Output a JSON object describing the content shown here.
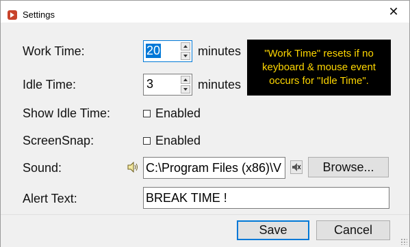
{
  "window": {
    "title": "Settings",
    "close_glyph": "✕"
  },
  "form": {
    "work_time": {
      "label": "Work Time:",
      "value": "20",
      "unit": "minutes"
    },
    "idle_time": {
      "label": "Idle Time:",
      "value": "3",
      "unit": "minutes"
    },
    "show_idle_time": {
      "label": "Show Idle Time:",
      "checkbox_label": "Enabled",
      "checked": false
    },
    "screen_snap": {
      "label": "ScreenSnap:",
      "checkbox_label": "Enabled",
      "checked": false
    },
    "sound": {
      "label": "Sound:",
      "path": "C:\\Program Files (x86)\\V",
      "browse_label": "Browse..."
    },
    "alert_text": {
      "label": "Alert Text:",
      "value": "BREAK TIME !"
    }
  },
  "tooltip": {
    "text": "\"Work Time\" resets if no keyboard & mouse event occurs for \"Idle Time\"."
  },
  "footer": {
    "save_label": "Save",
    "cancel_label": "Cancel"
  },
  "colors": {
    "accent": "#0078d7",
    "tooltip_bg": "#000000",
    "tooltip_text": "#ffd700"
  }
}
